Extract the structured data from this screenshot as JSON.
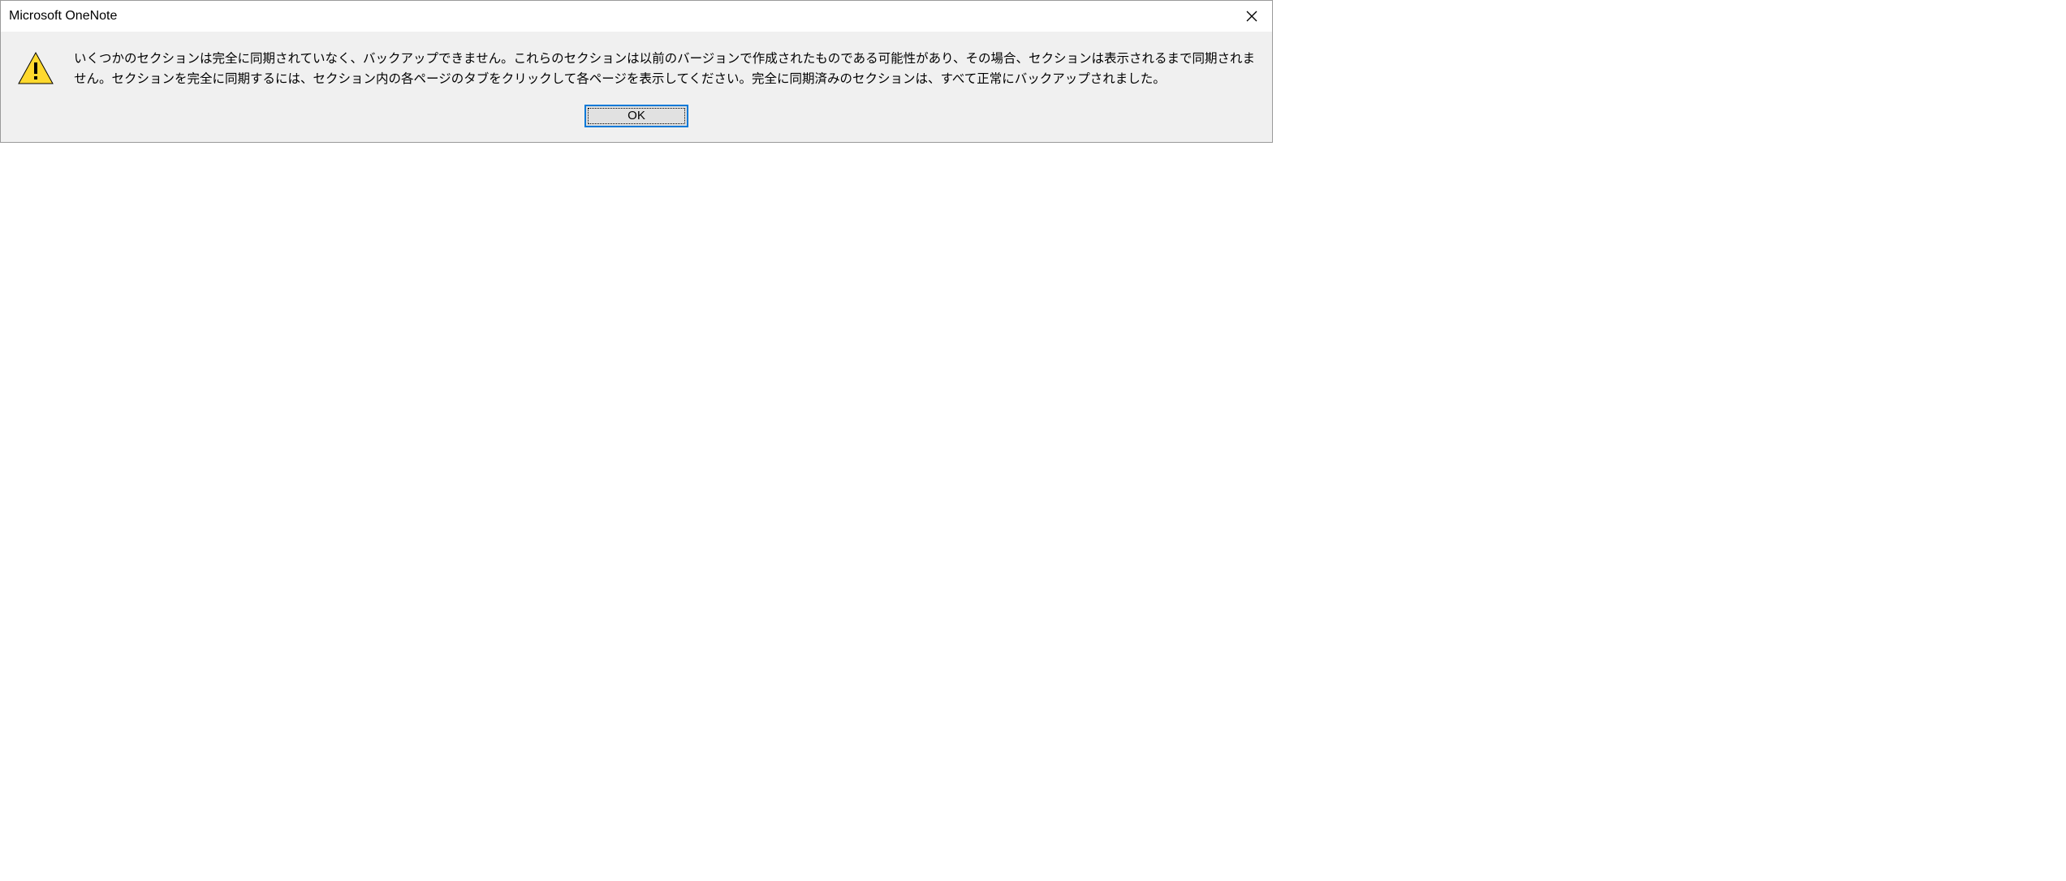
{
  "dialog": {
    "title": "Microsoft OneNote",
    "message": "いくつかのセクションは完全に同期されていなく、バックアップできません。これらのセクションは以前のバージョンで作成されたものである可能性があり、その場合、セクションは表示されるまで同期されません。セクションを完全に同期するには、セクション内の各ページのタブをクリックして各ページを表示してください。完全に同期済みのセクションは、すべて正常にバックアップされました。",
    "ok_label": "OK"
  },
  "icons": {
    "warning": "warning-icon",
    "close": "close-icon"
  },
  "colors": {
    "dialog_bg": "#f0f0f0",
    "button_focus_border": "#0078d7",
    "button_bg": "#e1e1e1",
    "warning_fill": "#ffd92e",
    "warning_stroke": "#000000"
  }
}
